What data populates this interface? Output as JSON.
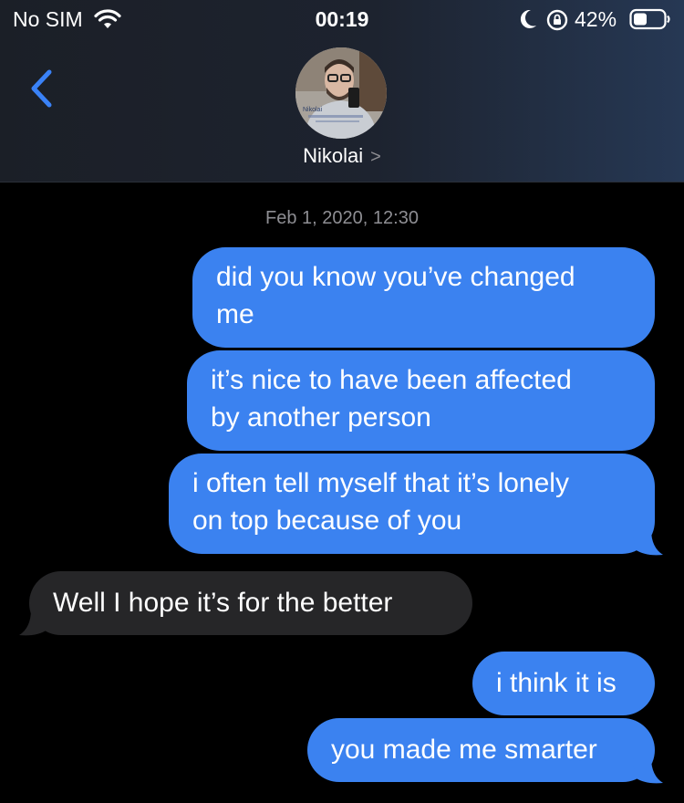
{
  "status_bar": {
    "carrier": "No SIM",
    "time": "00:19",
    "battery": "42%"
  },
  "header": {
    "contact_name": "Nikolai",
    "back_icon": "chevron-left-icon",
    "avatar_caption": "Nikolai"
  },
  "conversation": {
    "timestamp": "Feb 1, 2020, 12:30",
    "messages": [
      {
        "direction": "sent",
        "line1": "did you know you’ve changed",
        "line2": "me"
      },
      {
        "direction": "sent",
        "line1": "it’s nice to have been affected",
        "line2": "by another person"
      },
      {
        "direction": "sent",
        "line1": "i often tell myself that it’s lonely",
        "line2": "on top because of you"
      },
      {
        "direction": "received",
        "line1": "Well I hope it’s for the better"
      },
      {
        "direction": "sent",
        "line1": "i think it is"
      },
      {
        "direction": "sent",
        "line1": "you made me smarter"
      }
    ]
  },
  "colors": {
    "sent_bubble": "#3b82f0",
    "received_bubble": "#262628",
    "accent": "#3a82f7",
    "background": "#000000"
  }
}
